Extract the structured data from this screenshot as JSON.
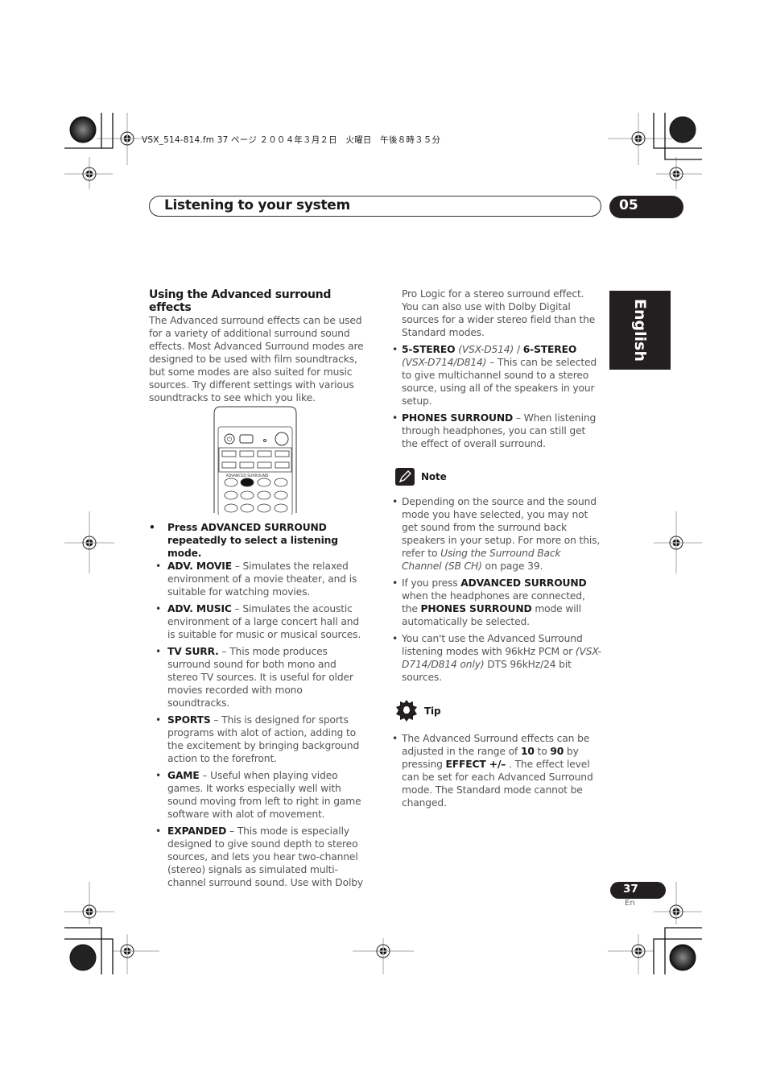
{
  "print_header": "VSX_514-814.fm  37 ページ  ２００４年３月２日　火曜日　午後８時３５分",
  "section_title": "Listening to your system",
  "chapter_number": "05",
  "language_tab": "English",
  "left": {
    "heading": "Using the Advanced surround effects",
    "intro": "The Advanced surround effects can be used for a variety of additional surround sound effects. Most Advanced Surround modes are designed to be used with film soundtracks, but some modes are also suited for music sources. Try different settings with various soundtracks to see which you like.",
    "remote_label": "ADVANCED SURROUND",
    "instruction": "Press ADVANCED SURROUND repeatedly to select a listening mode.",
    "modes": [
      {
        "name": "ADV. MOVIE",
        "desc": " – Simulates the relaxed environment of a movie theater, and is suitable for watching movies."
      },
      {
        "name": "ADV. MUSIC",
        "desc": " – Simulates the acoustic environment of a large concert hall and is suitable for music or musical sources."
      },
      {
        "name": "TV SURR.",
        "desc": " – This mode produces surround sound for both mono and stereo TV sources. It is useful for older movies recorded with mono soundtracks."
      },
      {
        "name": "SPORTS",
        "desc": " – This is designed for sports programs with alot of action, adding to the excitement by bringing background action to the forefront."
      },
      {
        "name": "GAME",
        "desc": " – Useful when playing video games. It works especially well with sound moving from left to right in game software with alot of movement."
      },
      {
        "name": "EXPANDED",
        "desc": " – This mode is especially designed to give sound depth to stereo sources, and lets you hear two-channel (stereo) signals as simulated multi-channel surround sound. Use with Dolby"
      }
    ]
  },
  "right": {
    "continuation": "Pro Logic for a stereo surround effect. You can also use with Dolby Digital sources for a wider stereo field than the Standard modes.",
    "stereo": {
      "name1": "5-STEREO",
      "model1": " (VSX-D514) ",
      "sep": "/ ",
      "name2": "6-STEREO",
      "model2": " (VSX-D714/D814)",
      "desc": " – This can be selected to give multichannel sound to a stereo source, using all of the speakers in your setup."
    },
    "phones": {
      "name": "PHONES SURROUND",
      "desc": " – When listening through headphones, you can still get the effect of overall surround."
    },
    "note_label": "Note",
    "notes": [
      {
        "text": "Depending on the source and the sound mode you have selected, you may not get sound from the surround back speakers in your setup. For more on this, refer to ",
        "ref": "Using the Surround Back Channel (SB CH)",
        "tail": " on page 39."
      },
      {
        "pre": "If you press ",
        "b1": "ADVANCED SURROUND",
        "mid": " when the headphones are connected, the ",
        "b2": "PHONES SURROUND",
        "tail": " mode will automatically be selected."
      },
      {
        "pre": "You can't use the Advanced Surround listening modes with 96kHz PCM or ",
        "it": "(VSX-D714/D814 only)",
        "tail": " DTS 96kHz/24 bit sources."
      }
    ],
    "tip_label": "Tip",
    "tip": {
      "pre": "The Advanced Surround effects can be adjusted in the range of ",
      "min": "10",
      "to": " to ",
      "max": "90",
      "mid": " by pressing ",
      "key": "EFFECT +/–",
      "tail": " . The effect level can be set for each Advanced Surround mode. The Standard mode cannot be changed."
    }
  },
  "footer": {
    "page_number": "37",
    "lang_code": "En"
  }
}
